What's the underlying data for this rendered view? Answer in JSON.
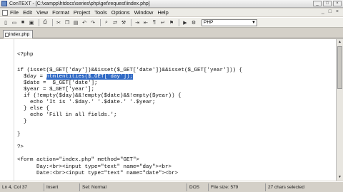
{
  "window": {
    "title": "ConTEXT - [C:\\xampp\\htdocs\\series\\php\\get\\request\\index.php]"
  },
  "menu": [
    "File",
    "Edit",
    "View",
    "Format",
    "Project",
    "Tools",
    "Options",
    "Window",
    "Help"
  ],
  "toolbar": {
    "language": "PHP"
  },
  "tab": {
    "label": "index.php"
  },
  "code": [
    "<?php",
    "",
    "if (isset($_GET['day'])&&isset($_GET['date'])&&isset($_GET['year'])) {",
    "  $day = ",
    "  $date =  $_GET['date'];",
    "  $year = $_GET['year'];",
    "  if (!empty($day)&&!empty($date)&&!empty($year)) {",
    "    echo 'It is '.$day.' '.$date.' '.$year;",
    "  } else {",
    "    echo 'Fill in all fields.';",
    "  }",
    "",
    "}",
    "",
    "?>",
    "",
    "<form action=\"index.php\" method=\"GET\">",
    "      Day:<br><input type=\"text\" name=\"day\"><br>",
    "      Date:<br><input type=\"text\" name=\"date\"><br>"
  ],
  "selection": "htmlentities($_GET['day']);",
  "status": {
    "position": "Ln 4, Col 37",
    "mode": "Insert",
    "modified": "Sel: Normal",
    "encoding": "DOS",
    "filesize": "File size: 579",
    "chars": "27 chars selected"
  }
}
